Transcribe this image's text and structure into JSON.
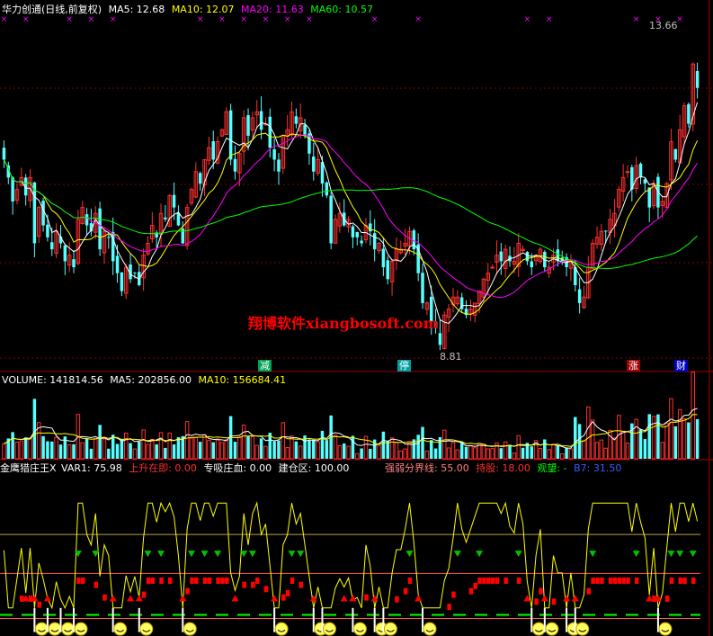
{
  "header": {
    "title": "华力创通(日线,前复权)",
    "ma": [
      {
        "label": "MA5: 12.68",
        "color": "#ffffff"
      },
      {
        "label": "MA10: 12.07",
        "color": "#ffff00"
      },
      {
        "label": "MA20: 11.63",
        "color": "#ff00ff"
      },
      {
        "label": "MA60: 10.57",
        "color": "#00ff00"
      }
    ]
  },
  "watermark": "翔博软件xiangbosoft.com",
  "price_annotations": {
    "high": "13.66",
    "low": "8.81"
  },
  "markers": [
    {
      "text": "减",
      "bg": "#00a050",
      "fg": "#ffffff"
    },
    {
      "text": "停",
      "bg": "#00a0a0",
      "fg": "#ffffff"
    },
    {
      "text": "涨",
      "bg": "#a00000",
      "fg": "#ffffff"
    },
    {
      "text": "财",
      "bg": "#0000c0",
      "fg": "#ffffff"
    }
  ],
  "volume_header": {
    "volume": "VOLUME: 141814.56",
    "ma5": "MA5: 202856.00",
    "ma10": "MA10: 156684.41"
  },
  "indicator_header": {
    "name": "金鹰猎庄王X",
    "var1": "VAR1: 75.98",
    "rise": "上升在即: 0.00",
    "absorb": "专吸庄血: 0.00",
    "build": "建仓区: 100.00",
    "divide": "强弱分界线: 55.00",
    "hold": "持股: 18.00",
    "watch": "观望: -",
    "b7": "B7: 31.50"
  },
  "colors": {
    "up": "#ff3030",
    "down": "#54ffff",
    "ma5": "#ffffff",
    "ma10": "#ffff00",
    "ma20": "#ff00ff",
    "ma60": "#00ff00",
    "grid": "#800000",
    "accent": "#ff4040"
  },
  "chart_data": {
    "type": "candlestick",
    "n": 200,
    "price_range": [
      8.3,
      14.2
    ],
    "closes": [
      11.8,
      11.5,
      11.1,
      11.3,
      11.5,
      11.2,
      11.5,
      10.4,
      11.0,
      10.7,
      10.5,
      10.3,
      10.6,
      10.4,
      10.1,
      10.2,
      10.0,
      10.8,
      11.0,
      10.7,
      10.6,
      10.9,
      10.3,
      10.6,
      10.5,
      10.1,
      9.9,
      9.6,
      10.0,
      9.8,
      9.9,
      9.7,
      10.2,
      10.4,
      10.7,
      10.5,
      10.9,
      10.8,
      11.2,
      11.0,
      10.7,
      10.4,
      11.0,
      11.3,
      11.6,
      11.4,
      11.8,
      12.0,
      11.8,
      12.1,
      12.3,
      12.6,
      11.8,
      11.6,
      11.9,
      12.5,
      12.2,
      12.5,
      12.6,
      12.3,
      12.4,
      12.0,
      11.8,
      11.6,
      12.2,
      12.3,
      12.6,
      12.4,
      12.5,
      12.2,
      11.9,
      11.6,
      11.8,
      11.4,
      11.2,
      10.4,
      10.8,
      10.9,
      10.7,
      10.8,
      10.5,
      10.5,
      10.4,
      10.7,
      10.6,
      10.3,
      10.4,
      10.0,
      9.8,
      10.1,
      10.3,
      10.3,
      10.4,
      10.6,
      10.3,
      9.9,
      9.4,
      9.4,
      9.1,
      9.0,
      8.7,
      9.2,
      9.3,
      9.5,
      9.5,
      9.3,
      9.2,
      9.3,
      9.4,
      9.6,
      9.8,
      9.9,
      10.0,
      10.2,
      10.1,
      10.3,
      10.1,
      10.1,
      10.4,
      10.3,
      10.1,
      10.0,
      10.2,
      10.3,
      10.0,
      10.0,
      10.2,
      10.1,
      10.1,
      10.0,
      10.1,
      9.7,
      9.4,
      9.5,
      10.0,
      10.4,
      10.5,
      10.6,
      10.6,
      10.8,
      10.9,
      11.3,
      11.5,
      11.6,
      11.3,
      11.7,
      11.5,
      11.4,
      11.0,
      11.4,
      11.0,
      11.1,
      11.4,
      12.1,
      11.8,
      12.3,
      12.7,
      12.4,
      13.4,
      13.0
    ],
    "volume_range": [
      0,
      600000
    ],
    "indicator": {
      "levels": [
        55,
        18,
        -25
      ],
      "var1_last": 75.98
    }
  }
}
